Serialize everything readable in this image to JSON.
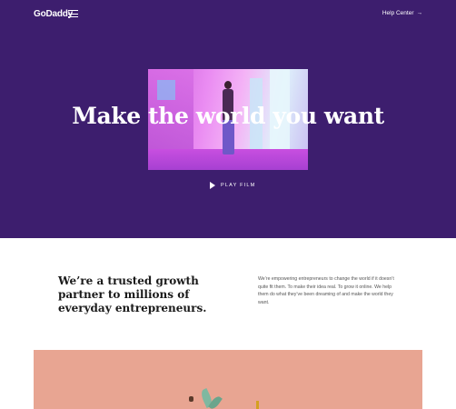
{
  "header": {
    "logo_text": "GoDaddy",
    "help_label": "Help Center",
    "help_arrow": "→"
  },
  "hero": {
    "headline": "Make the world you want",
    "play_label": "PLAY FILM",
    "background_color": "#3d1e6e"
  },
  "about": {
    "heading": "We’re a trusted growth partner to millions of everyday entrepreneurs.",
    "body": "We’re empowering entrepreneurs to change the world if it doesn’t quite fit them. To make their idea real. To grow it online. We help them do what they’ve been dreaming of and make the world they want."
  },
  "icons": {
    "menu": "hamburger-menu-icon",
    "help_arrow": "arrow-right-icon",
    "play": "play-icon"
  }
}
